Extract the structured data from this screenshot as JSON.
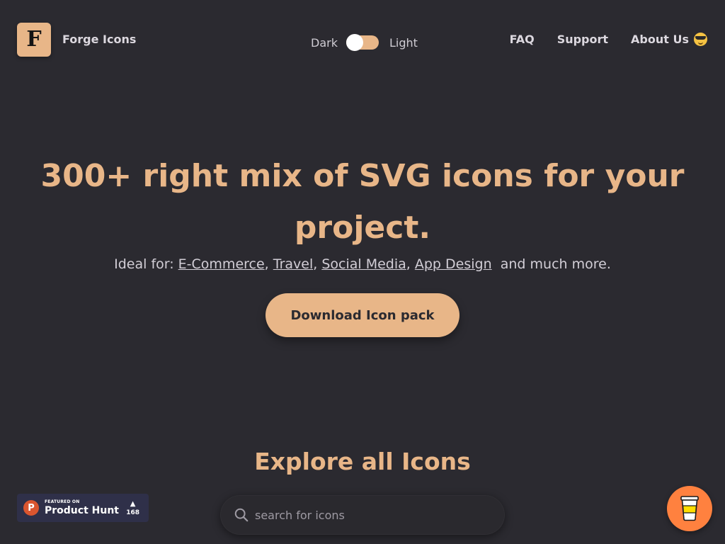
{
  "brand": {
    "logo_letter": "F",
    "name": "Forge Icons"
  },
  "theme": {
    "dark_label": "Dark",
    "light_label": "Light"
  },
  "nav": {
    "faq": "FAQ",
    "support": "Support",
    "about": "About Us"
  },
  "hero": {
    "title_line1": "300+ right mix of SVG icons for your",
    "title_line2": "project.",
    "ideal_prefix": "Ideal for: ",
    "categories": [
      "E-Commerce",
      "Travel",
      "Social Media",
      "App Design"
    ],
    "ideal_suffix": "and much more.",
    "download_label": "Download Icon pack"
  },
  "explore": {
    "title": "Explore all Icons",
    "search_placeholder": "search for icons"
  },
  "product_hunt": {
    "featured": "FEATURED ON",
    "name": "Product Hunt",
    "votes": "168",
    "logo_letter": "P"
  },
  "colors": {
    "background": "#2b2a30",
    "accent": "#e8b688",
    "coffee": "#ff813f",
    "ph_orange": "#da552f"
  },
  "icons": [
    "search-icon",
    "coffee-cup-icon",
    "sunglasses-emoji-icon",
    "upvote-arrow-icon"
  ]
}
